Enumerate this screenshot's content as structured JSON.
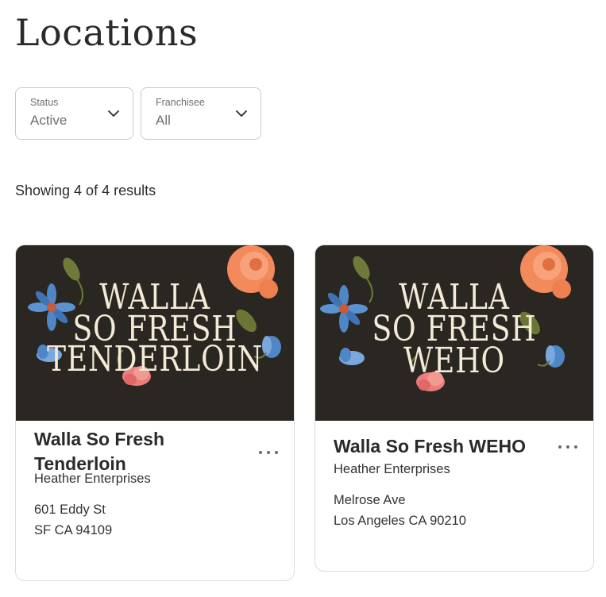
{
  "page": {
    "title": "Locations"
  },
  "filters": {
    "status": {
      "label": "Status",
      "value": "Active"
    },
    "franchisee": {
      "label": "Franchisee",
      "value": "All"
    }
  },
  "results": {
    "summary": "Showing 4 of 4 results"
  },
  "locations": [
    {
      "name": "Walla So Fresh Tenderloin",
      "franchisee": "Heather Enterprises",
      "address_line1": "601 Eddy St",
      "address_line2": "SF CA 94109",
      "banner": {
        "line1": "WALLA",
        "line2": "SO FRESH",
        "line3": "TENDERLOIN"
      }
    },
    {
      "name": "Walla So Fresh WEHO",
      "franchisee": "Heather Enterprises",
      "address_line1": "Melrose Ave",
      "address_line2": "Los Angeles CA 90210",
      "banner": {
        "line1": "WALLA",
        "line2": "SO FRESH",
        "line3": "WEHO"
      }
    }
  ],
  "icons": {
    "dropdown": "chevron-down-icon",
    "more": "more-options-icon"
  },
  "colors": {
    "banner_background": "#2a2621",
    "banner_text": "#f3ead8",
    "rose": "#f28a5c",
    "blue_flower": "#4f86c6",
    "pink_flower": "#ec7d7d"
  }
}
